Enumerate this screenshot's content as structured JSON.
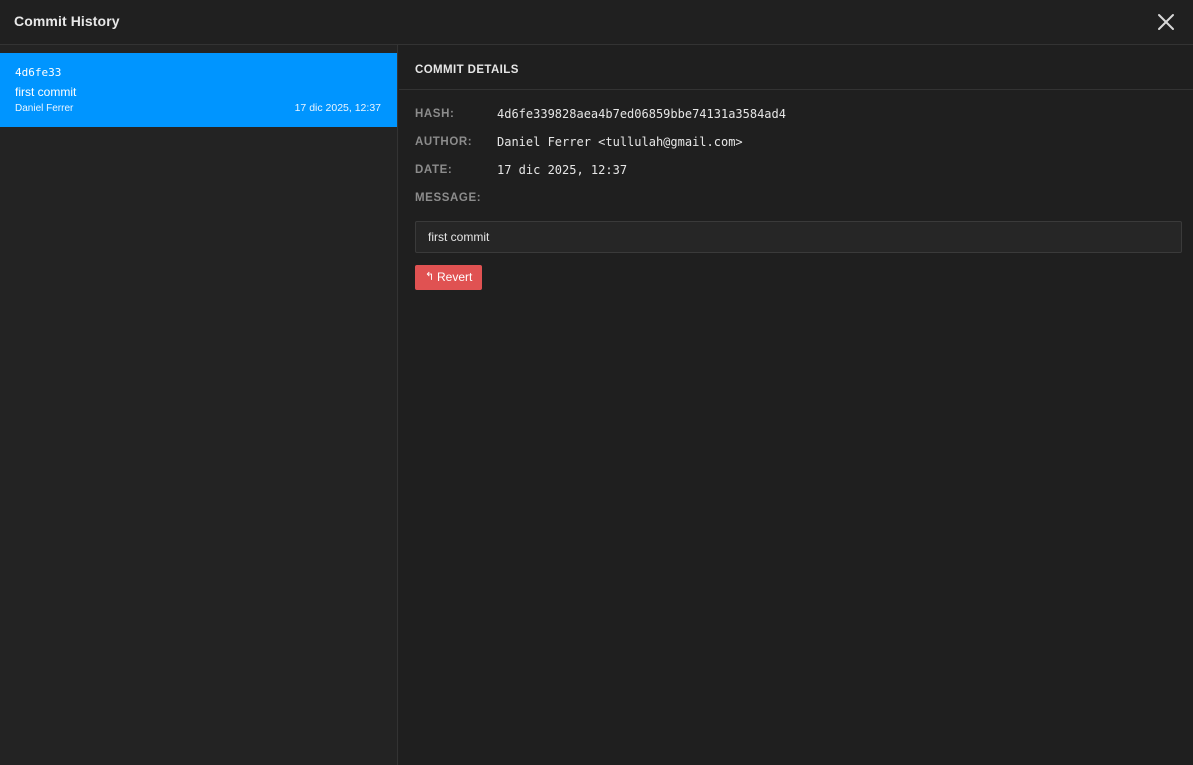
{
  "header": {
    "title": "Commit History",
    "close_icon": "close-icon"
  },
  "commits": [
    {
      "short_hash": "4d6fe33",
      "message": "first commit",
      "author": "Daniel Ferrer",
      "date": "17 dic 2025, 12:37",
      "selected": true
    }
  ],
  "details": {
    "title": "COMMIT DETAILS",
    "hash_label": "HASH:",
    "hash_value": "4d6fe339828aea4b7ed06859bbe74131a3584ad4",
    "author_label": "AUTHOR:",
    "author_value": "Daniel Ferrer <tullulah@gmail.com>",
    "date_label": "DATE:",
    "date_value": "17 dic 2025, 12:37",
    "message_label": "MESSAGE:",
    "message_value": "first commit",
    "revert_icon": "revert-icon",
    "revert_glyph": "↰",
    "revert_label": "Revert"
  },
  "colors": {
    "selected_item": "#0095ff",
    "revert_button": "#e05252",
    "background": "#202020"
  }
}
